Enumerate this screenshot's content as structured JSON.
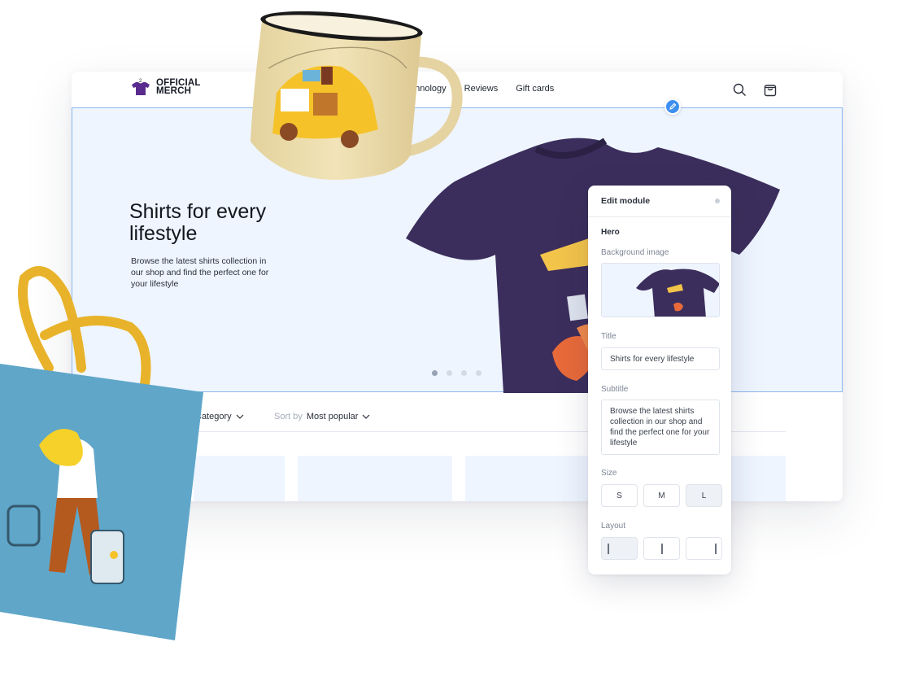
{
  "brand": {
    "logo_text": "OFFICIAL\nMERCH",
    "logo_badge": "2",
    "shirt_color": "#5a2b8e"
  },
  "nav": {
    "items": [
      "Technology",
      "Reviews",
      "Gift cards"
    ],
    "icons": [
      "search-icon",
      "bag-icon"
    ]
  },
  "hero": {
    "title": "Shirts for every lifestyle",
    "subtitle": "Browse the latest shirts collection in our shop and find the perfect one for your lifestyle",
    "slides_total": 4,
    "slide_active": 1,
    "background": "#eef5ff",
    "selection_color": "#8db7ee",
    "shirt_color": "#3b2e5c"
  },
  "filters": {
    "category_label": "Category",
    "sort_prefix": "Sort by",
    "sort_value": "Most popular"
  },
  "panel": {
    "title": "Edit module",
    "section": "Hero",
    "background_label": "Background image",
    "title_label": "Title",
    "title_value": "Shirts for every lifestyle",
    "subtitle_label": "Subtitle",
    "subtitle_value": "Browse the latest shirts collection in our shop and find the perfect one for your lifestyle",
    "size_label": "Size",
    "sizes": [
      "S",
      "M",
      "L"
    ],
    "size_selected": "L",
    "layout_label": "Layout",
    "layouts": [
      "left",
      "center",
      "right"
    ],
    "layout_selected": "left"
  },
  "colors": {
    "accent": "#3d8ff0",
    "mug": "#efe0b0",
    "bag": "#5fa6c9",
    "bag_handle": "#e8b32a"
  }
}
